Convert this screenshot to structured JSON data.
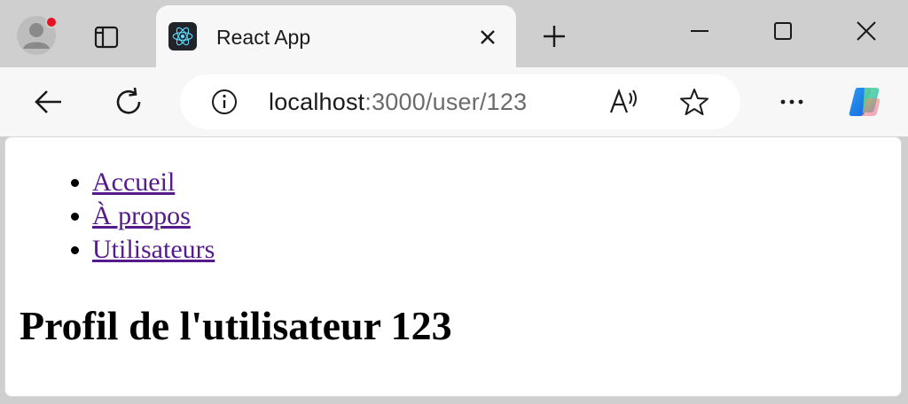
{
  "browser": {
    "tab": {
      "title": "React App",
      "favicon": "react-logo-icon"
    },
    "address_bar": {
      "url_host": "localhost",
      "url_rest": ":3000/user/123"
    },
    "icons": {
      "profile": "profile-avatar-icon",
      "tab_actions": "tab-actions-icon",
      "tab_close": "close-icon",
      "new_tab": "plus-icon",
      "minimize": "minimize-icon",
      "maximize": "maximize-icon",
      "window_close": "close-icon",
      "back": "arrow-left-icon",
      "reload": "reload-icon",
      "site_info": "info-icon",
      "read_aloud": "read-aloud-icon",
      "favorite": "star-icon",
      "more": "more-icon",
      "copilot": "copilot-icon"
    },
    "colors": {
      "notification_dot": "#e81123",
      "link_visited": "#551a8b"
    }
  },
  "page": {
    "nav": {
      "items": [
        {
          "label": "Accueil"
        },
        {
          "label": "À propos"
        },
        {
          "label": "Utilisateurs"
        }
      ]
    },
    "heading": "Profil de l'utilisateur 123"
  }
}
